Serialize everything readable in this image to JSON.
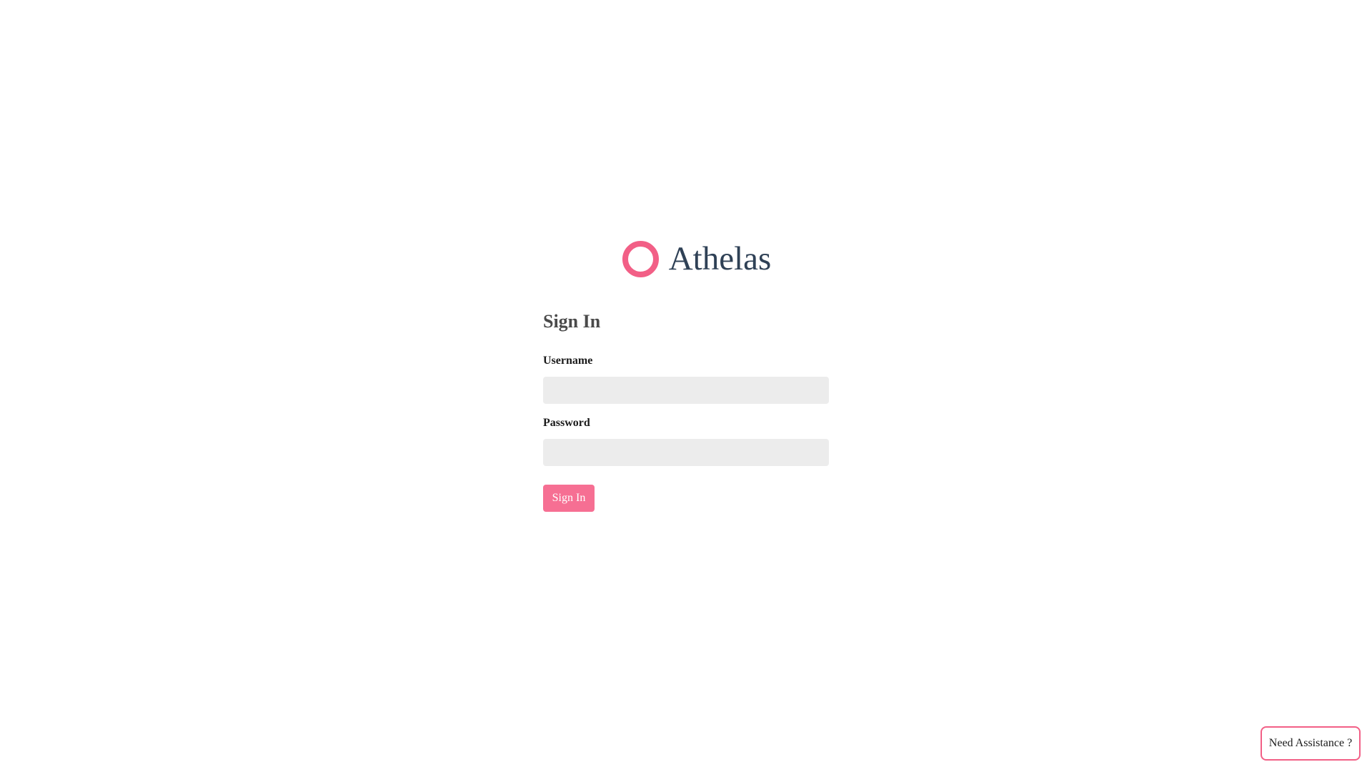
{
  "brand": {
    "name": "Athelas",
    "logo_icon": "ring-logo-icon",
    "accent_color": "#f25f86"
  },
  "form": {
    "title": "Sign In",
    "username_label": "Username",
    "username_value": "",
    "password_label": "Password",
    "password_value": "",
    "submit_label": "Sign In"
  },
  "help": {
    "label": "Need Assistance ?"
  },
  "colors": {
    "brand_text": "#2f4156",
    "button": "#f66f93",
    "input_bg": "#ececec"
  }
}
